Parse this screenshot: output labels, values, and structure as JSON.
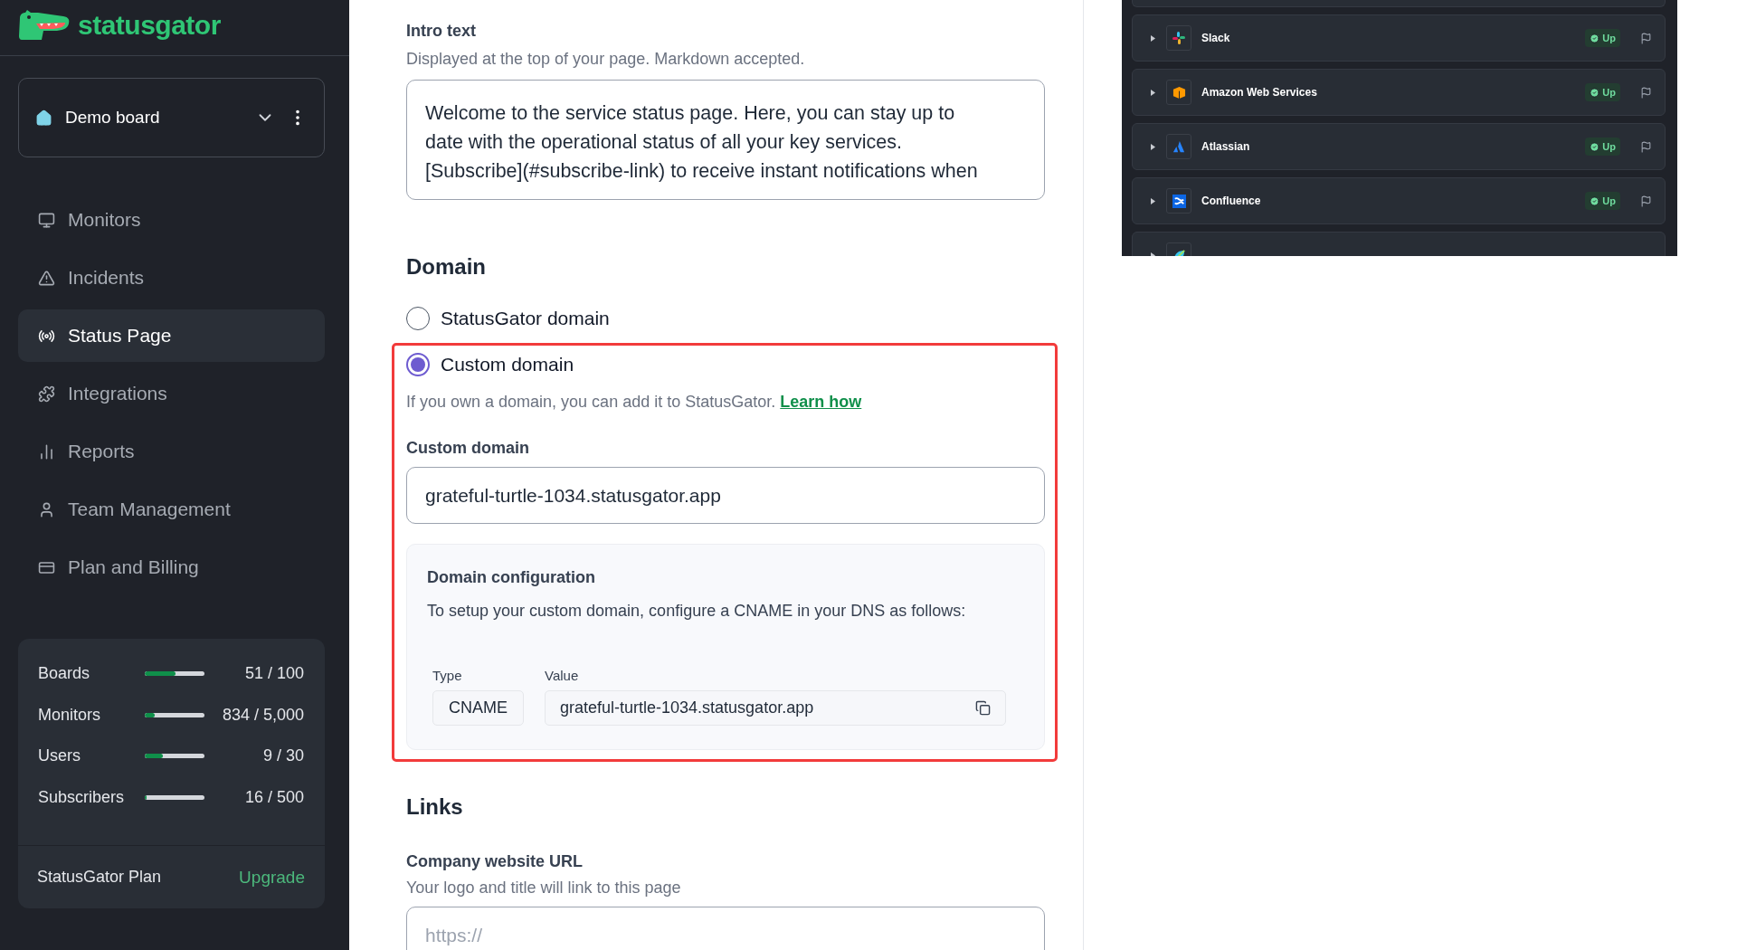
{
  "sidebar": {
    "logo": "statusgator",
    "board": {
      "name": "Demo board"
    },
    "nav": [
      {
        "label": "Monitors",
        "selected": false
      },
      {
        "label": "Incidents",
        "selected": false
      },
      {
        "label": "Status Page",
        "selected": true
      },
      {
        "label": "Integrations",
        "selected": false
      },
      {
        "label": "Reports",
        "selected": false
      },
      {
        "label": "Team Management",
        "selected": false
      },
      {
        "label": "Plan and Billing",
        "selected": false
      }
    ],
    "usage": [
      {
        "label": "Boards",
        "level": 0.51,
        "reading": "51 / 100"
      },
      {
        "label": "Monitors",
        "level": 0.17,
        "reading": "834 / 5,000"
      },
      {
        "label": "Users",
        "level": 0.3,
        "reading": "9 / 30"
      },
      {
        "label": "Subscribers",
        "level": 0.03,
        "reading": "16 / 500"
      }
    ],
    "plan": {
      "label": "StatusGator Plan",
      "action": "Upgrade"
    }
  },
  "form": {
    "intro": {
      "label": "Intro text",
      "hint": "Displayed at the top of your page. Markdown accepted.",
      "value": "Welcome to the service status page. Here, you can stay up to date with the operational status of all your key services. [Subscribe](#subscribe-link) to receive instant notifications when"
    },
    "domain": {
      "heading": "Domain",
      "options": [
        {
          "label": "StatusGator domain",
          "selected": false
        },
        {
          "label": "Custom domain",
          "selected": true
        }
      ],
      "help": "If you own a domain, you can add it to StatusGator.",
      "help_link": "Learn how",
      "field_label": "Custom domain",
      "value": "grateful-turtle-1034.statusgator.app",
      "config": {
        "title": "Domain configuration",
        "text": "To setup your custom domain, configure a CNAME in your DNS as follows:",
        "type_label": "Type",
        "value_label": "Value",
        "type": "CNAME",
        "value": "grateful-turtle-1034.statusgator.app"
      }
    },
    "links": {
      "heading": "Links",
      "label": "Company website URL",
      "hint": "Your logo and title will link to this page",
      "placeholder": "https://"
    }
  },
  "preview": {
    "services": [
      {
        "name": "Slack",
        "status": "Up"
      },
      {
        "name": "Amazon Web Services",
        "status": "Up"
      },
      {
        "name": "Atlassian",
        "status": "Up"
      },
      {
        "name": "Confluence",
        "status": "Up"
      }
    ]
  }
}
